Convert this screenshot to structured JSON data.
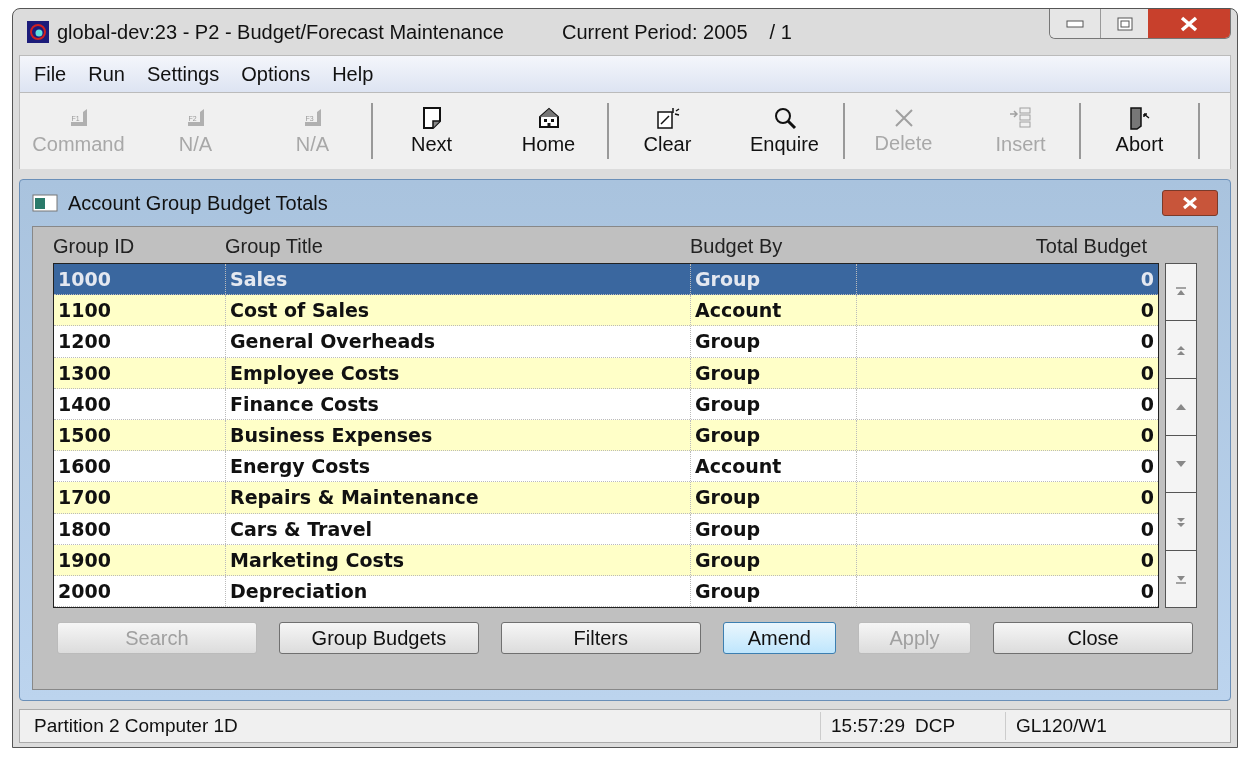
{
  "window": {
    "title": "global-dev:23 - P2 - Budget/Forecast Maintenance",
    "period": "Current Period: 2005",
    "period_suffix": "/ 1"
  },
  "menu": [
    "File",
    "Run",
    "Settings",
    "Options",
    "Help"
  ],
  "toolbar_groups": [
    [
      {
        "label": "Command",
        "key": "F1",
        "kind": "fkey",
        "enabled": false
      },
      {
        "label": "N/A",
        "key": "F2",
        "kind": "fkey",
        "enabled": false
      },
      {
        "label": "N/A",
        "key": "F3",
        "kind": "fkey",
        "enabled": false
      }
    ],
    [
      {
        "label": "Next",
        "kind": "page",
        "enabled": true
      },
      {
        "label": "Home",
        "kind": "house",
        "enabled": true
      }
    ],
    [
      {
        "label": "Clear",
        "kind": "clear",
        "enabled": true
      },
      {
        "label": "Enquire",
        "kind": "search",
        "enabled": true
      }
    ],
    [
      {
        "label": "Delete",
        "kind": "cross",
        "enabled": false
      },
      {
        "label": "Insert",
        "kind": "insert",
        "enabled": false
      }
    ],
    [
      {
        "label": "Abort",
        "kind": "door",
        "enabled": true
      }
    ]
  ],
  "dialog": {
    "title": "Account Group Budget Totals",
    "table": {
      "columns": [
        "Group ID",
        "Group Title",
        "Budget By",
        "Total Budget"
      ],
      "rows": [
        {
          "cells": [
            "1000",
            "Sales",
            "Group",
            "0"
          ],
          "selected": true
        },
        {
          "cells": [
            "1100",
            "Cost of Sales",
            "Account",
            "0"
          ],
          "selected": false
        },
        {
          "cells": [
            "1200",
            "General Overheads",
            "Group",
            "0"
          ],
          "selected": false
        },
        {
          "cells": [
            "1300",
            "Employee Costs",
            "Group",
            "0"
          ],
          "selected": false
        },
        {
          "cells": [
            "1400",
            "Finance Costs",
            "Group",
            "0"
          ],
          "selected": false
        },
        {
          "cells": [
            "1500",
            "Business Expenses",
            "Group",
            "0"
          ],
          "selected": false
        },
        {
          "cells": [
            "1600",
            "Energy Costs",
            "Account",
            "0"
          ],
          "selected": false
        },
        {
          "cells": [
            "1700",
            "Repairs & Maintenance",
            "Group",
            "0"
          ],
          "selected": false
        },
        {
          "cells": [
            "1800",
            "Cars & Travel",
            "Group",
            "0"
          ],
          "selected": false
        },
        {
          "cells": [
            "1900",
            "Marketing Costs",
            "Group",
            "0"
          ],
          "selected": false
        },
        {
          "cells": [
            "2000",
            "Depreciation",
            "Group",
            "0"
          ],
          "selected": false
        }
      ]
    },
    "buttons": [
      {
        "label": "Search",
        "enabled": false,
        "default": false
      },
      {
        "label": "Group Budgets",
        "enabled": true,
        "default": false
      },
      {
        "label": "Filters",
        "enabled": true,
        "default": false
      },
      {
        "label": "Amend",
        "enabled": true,
        "default": true
      },
      {
        "label": "Apply",
        "enabled": false,
        "default": false
      },
      {
        "label": "Close",
        "enabled": true,
        "default": false
      }
    ]
  },
  "status_bar": {
    "message": "Partition 2 Computer 1D",
    "time": "15:57:29",
    "user": "DCP",
    "program": "GL120/W1"
  }
}
